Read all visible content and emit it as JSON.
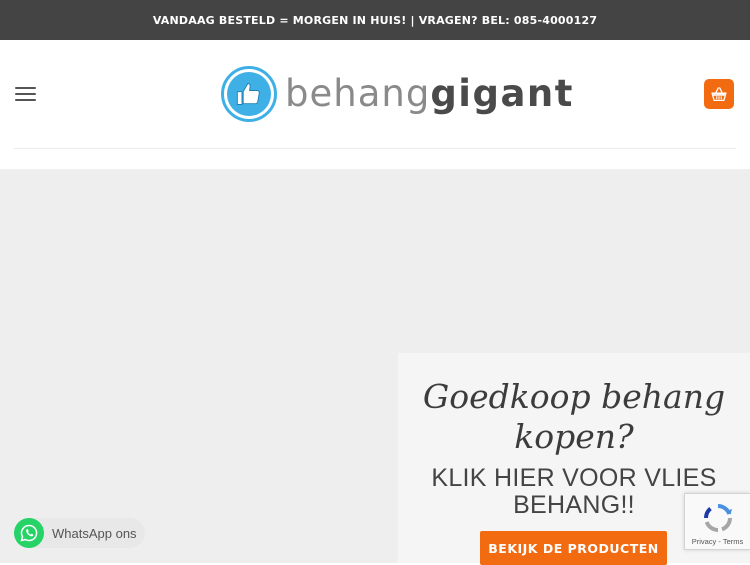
{
  "announcement": {
    "text": "VANDAAG BESTELD = MORGEN IN HUIS! | VRAGEN? BEL: 085-4000127"
  },
  "header": {
    "menu_icon": "hamburger-menu-icon",
    "logo": {
      "icon": "thumbs-up-icon",
      "text_light": "behang",
      "text_bold": "gigant"
    },
    "cart_icon": "basket-icon"
  },
  "promo": {
    "script_line_1": "Goedkoop behang",
    "script_line_2": "kopen?",
    "headline": "KLIK HIER VOOR VLIES BEHANG!!",
    "button_label": "BEKIJK DE PRODUCTEN"
  },
  "whatsapp": {
    "label": "WhatsApp ons",
    "icon": "whatsapp-icon"
  },
  "recaptcha": {
    "privacy": "Privacy",
    "separator": " - ",
    "terms": "Terms",
    "icon": "recaptcha-icon"
  },
  "colors": {
    "topbar_bg": "#444444",
    "accent_orange": "#f36b10",
    "logo_blue": "#3fb0e6",
    "whatsapp_green": "#25d366",
    "hero_bg": "#eeeeef"
  }
}
